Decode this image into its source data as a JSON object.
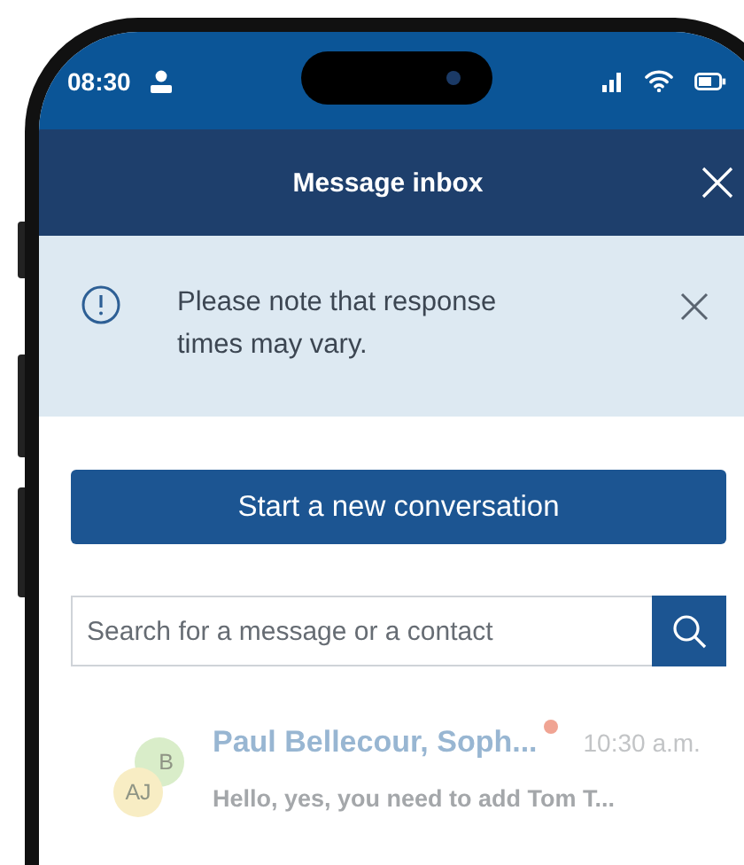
{
  "status_bar": {
    "time": "08:30"
  },
  "header": {
    "title": "Message inbox"
  },
  "notice": {
    "text": "Please note that response times may vary."
  },
  "new_conversation_button": {
    "label": "Start a new conversation"
  },
  "search": {
    "placeholder": "Search for a message or a contact"
  },
  "conversations": [
    {
      "avatars": [
        {
          "initials": "B",
          "color": "#d9edc9"
        },
        {
          "initials": "AJ",
          "color": "#f8edc4"
        }
      ],
      "name": "Paul Bellecour, Soph...",
      "unread": true,
      "time": "10:30 a.m.",
      "preview": "Hello, yes, you need to add Tom T..."
    }
  ]
}
